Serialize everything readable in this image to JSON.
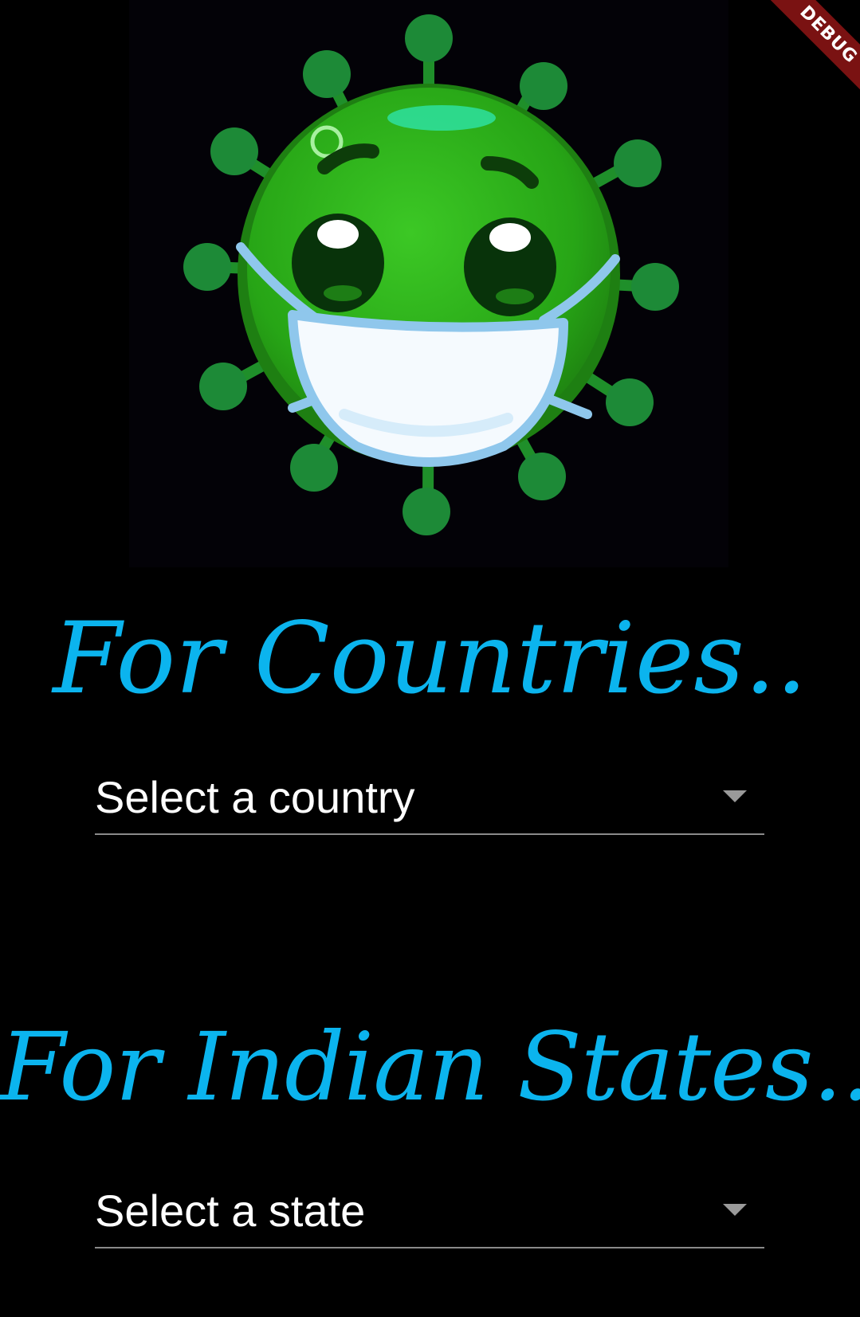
{
  "debug_banner": {
    "label": "DEBUG"
  },
  "hero": {
    "icon": "masked-virus-icon"
  },
  "countries_section": {
    "heading": "For Countries..",
    "dropdown_placeholder": "Select a country"
  },
  "states_section": {
    "heading": "For Indian States..",
    "dropdown_placeholder": "Select a state"
  },
  "colors": {
    "background": "#000000",
    "heading": "#0bb4ee",
    "dropdown_text": "#ffffff",
    "underline": "#8a8a8a",
    "virus_green": "#2fb41c",
    "mask": "#ffffff",
    "banner": "#7a1212"
  }
}
